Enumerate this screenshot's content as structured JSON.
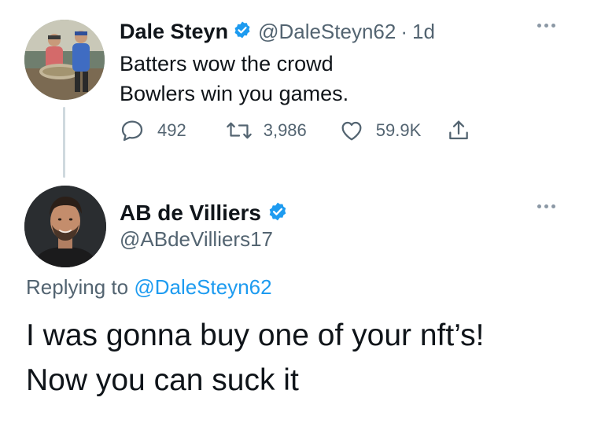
{
  "tweet1": {
    "author_name": "Dale Steyn",
    "handle": "@DaleSteyn62",
    "separator": "·",
    "time": "1d",
    "lines": [
      "Batters wow the crowd",
      "Bowlers win you games."
    ],
    "replies": "492",
    "retweets": "3,986",
    "likes": "59.9K"
  },
  "tweet2": {
    "author_name": "AB de Villiers",
    "handle": "@ABdeVilliers17",
    "replying_prefix": "Replying to",
    "replying_to": "@DaleSteyn62",
    "lines": [
      "I was gonna buy one of your nft’s!",
      "Now you can suck it"
    ]
  },
  "icons": {
    "verified": "verified-badge-icon",
    "more": "more-options-icon",
    "reply": "reply-icon",
    "retweet": "retweet-icon",
    "like": "heart-icon",
    "share": "share-icon"
  },
  "colors": {
    "verified_blue": "#1d9bf0",
    "secondary_text": "#536471",
    "link_blue": "#1d9bf0",
    "thread_line": "#cfd9de"
  }
}
